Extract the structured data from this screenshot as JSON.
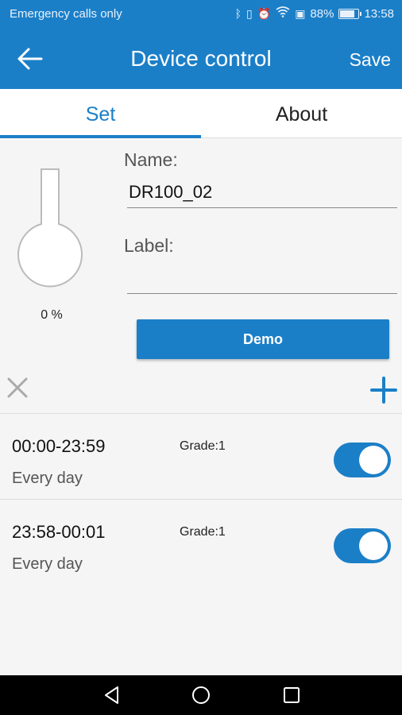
{
  "status_bar": {
    "carrier": "Emergency calls only",
    "icons": [
      "bluetooth-icon",
      "vibrate-icon",
      "alarm-icon",
      "wifi-icon",
      "battery-saver-icon"
    ],
    "battery_percent": "88%",
    "battery_level": 0.88,
    "time": "13:58"
  },
  "app_bar": {
    "back_icon": "arrow-left-icon",
    "title": "Device control",
    "save_label": "Save"
  },
  "tabs": [
    {
      "label": "Set",
      "selected": true
    },
    {
      "label": "About",
      "selected": false
    }
  ],
  "device": {
    "fill_percent_label": "0 %",
    "fill_level": 0,
    "name_label": "Name:",
    "name_value": "DR100_02",
    "label_label": "Label:",
    "label_value": "",
    "demo_label": "Demo"
  },
  "toolbar": {
    "delete_icon": "close-icon",
    "add_icon": "plus-icon"
  },
  "schedules": [
    {
      "time": "00:00-23:59",
      "repeat": "Every day",
      "grade": "Grade:1",
      "enabled": true
    },
    {
      "time": "23:58-00:01",
      "repeat": "Every day",
      "grade": "Grade:1",
      "enabled": true
    }
  ],
  "nav_bar": [
    "back-triangle-icon",
    "home-circle-icon",
    "recents-square-icon"
  ],
  "colors": {
    "accent": "#1b7fc8",
    "background": "#f5f5f5",
    "nav_bar": "#000000"
  }
}
